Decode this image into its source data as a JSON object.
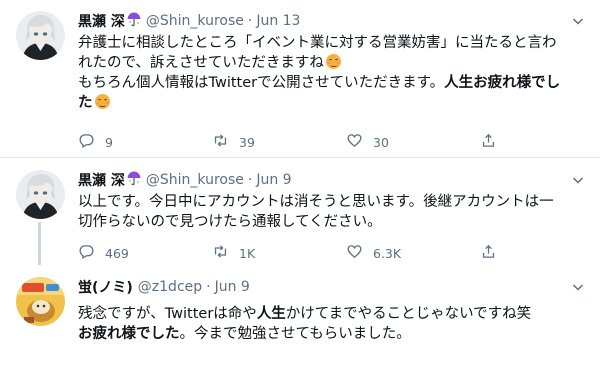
{
  "tweets": [
    {
      "name": "黒瀬 深",
      "handle": "@Shin_kurose",
      "date": "Jun 13",
      "line1": "弁護士に相談したところ「イベント業に対する営業妨害」に当たると言わ",
      "line2": "れたので、訴えさせていただきますね",
      "line3_plain": "もちろん個人情報はTwitterで公開させていただきます。",
      "line3_bold": "人生お疲れ様でし",
      "line4_bold": "た",
      "replies": "9",
      "retweets": "39",
      "likes": "30"
    },
    {
      "name": "黒瀬 深",
      "handle": "@Shin_kurose",
      "date": "Jun 9",
      "line1": "以上です。今日中にアカウントは消そうと思います。後継アカウントは一",
      "line2": "切作らないので見つけたら通報してください。",
      "replies": "469",
      "retweets": "1K",
      "likes": "6.3K"
    },
    {
      "name": "蛍(ノミ)",
      "handle": "@z1dcep",
      "date": "Jun 9",
      "line1_a": "残念ですが、Twitterは命や",
      "line1_bold": "人生",
      "line1_b": "かけてまでやることじゃないですね笑",
      "line2_bold": "お疲れ様でした",
      "line2_plain": "。今まで勉強させてもらいました。"
    }
  ],
  "colors": {
    "text": "#0f1419",
    "secondary": "#5b7083",
    "divider": "#e1e8ed",
    "thread_line": "#ccd6dd",
    "emoji": "#f7b13b"
  },
  "icons": [
    "chevron-down-icon",
    "reply-icon",
    "retweet-icon",
    "like-icon",
    "share-icon",
    "umbrella-icon",
    "smiling-face-icon"
  ]
}
